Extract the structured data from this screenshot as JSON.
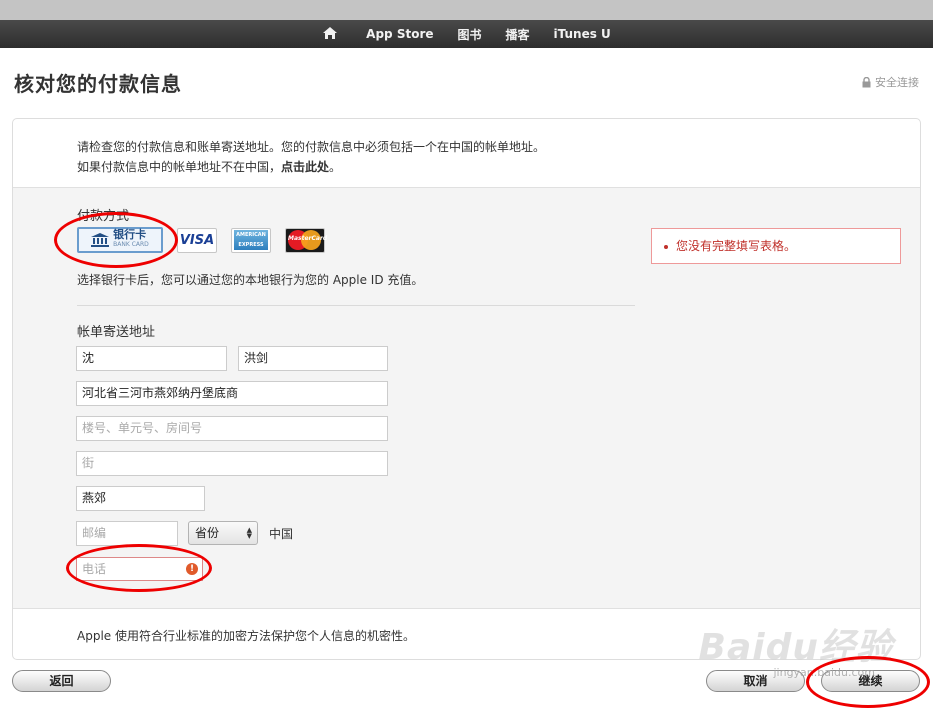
{
  "nav": {
    "items": [
      "App Store",
      "图书",
      "播客",
      "iTunes U"
    ]
  },
  "page": {
    "title": "核对您的付款信息",
    "secure_label": "安全连接"
  },
  "intro": {
    "line1": "请检查您的付款信息和账单寄送地址。您的付款信息中必须包括一个在中国的帐单地址。",
    "line2_prefix": "如果付款信息中的帐单地址不在中国，",
    "line2_link": "点击此处",
    "line2_suffix": "。"
  },
  "payment": {
    "label": "付款方式",
    "bank_card_cn": "银行卡",
    "bank_card_en": "BANK CARD",
    "visa": "VISA",
    "amex": "AMERICAN EXPRESS",
    "mastercard": "MasterCard",
    "hint": "选择银行卡后，您可以通过您的本地银行为您的 Apple ID 充值。"
  },
  "address": {
    "label": "帐单寄送地址",
    "last_name": "沈",
    "first_name": "洪剑",
    "line1": "河北省三河市燕郊纳丹堡底商",
    "line2_placeholder": "楼号、单元号、房间号",
    "street_placeholder": "街",
    "city": "燕郊",
    "postcode_placeholder": "邮编",
    "province": "省份",
    "country": "中国",
    "phone_placeholder": "电话"
  },
  "error": {
    "message": "您没有完整填写表格。"
  },
  "footer_note": "Apple 使用符合行业标准的加密方法保护您个人信息的机密性。",
  "buttons": {
    "back": "返回",
    "cancel": "取消",
    "continue": "继续"
  },
  "watermark": {
    "main": "Baidu经验",
    "sub": "jingyan.baidu.com"
  },
  "colors": {
    "navbar": "#2d2d2d",
    "error_red": "#c0312b",
    "annotation_red": "#e00000"
  }
}
